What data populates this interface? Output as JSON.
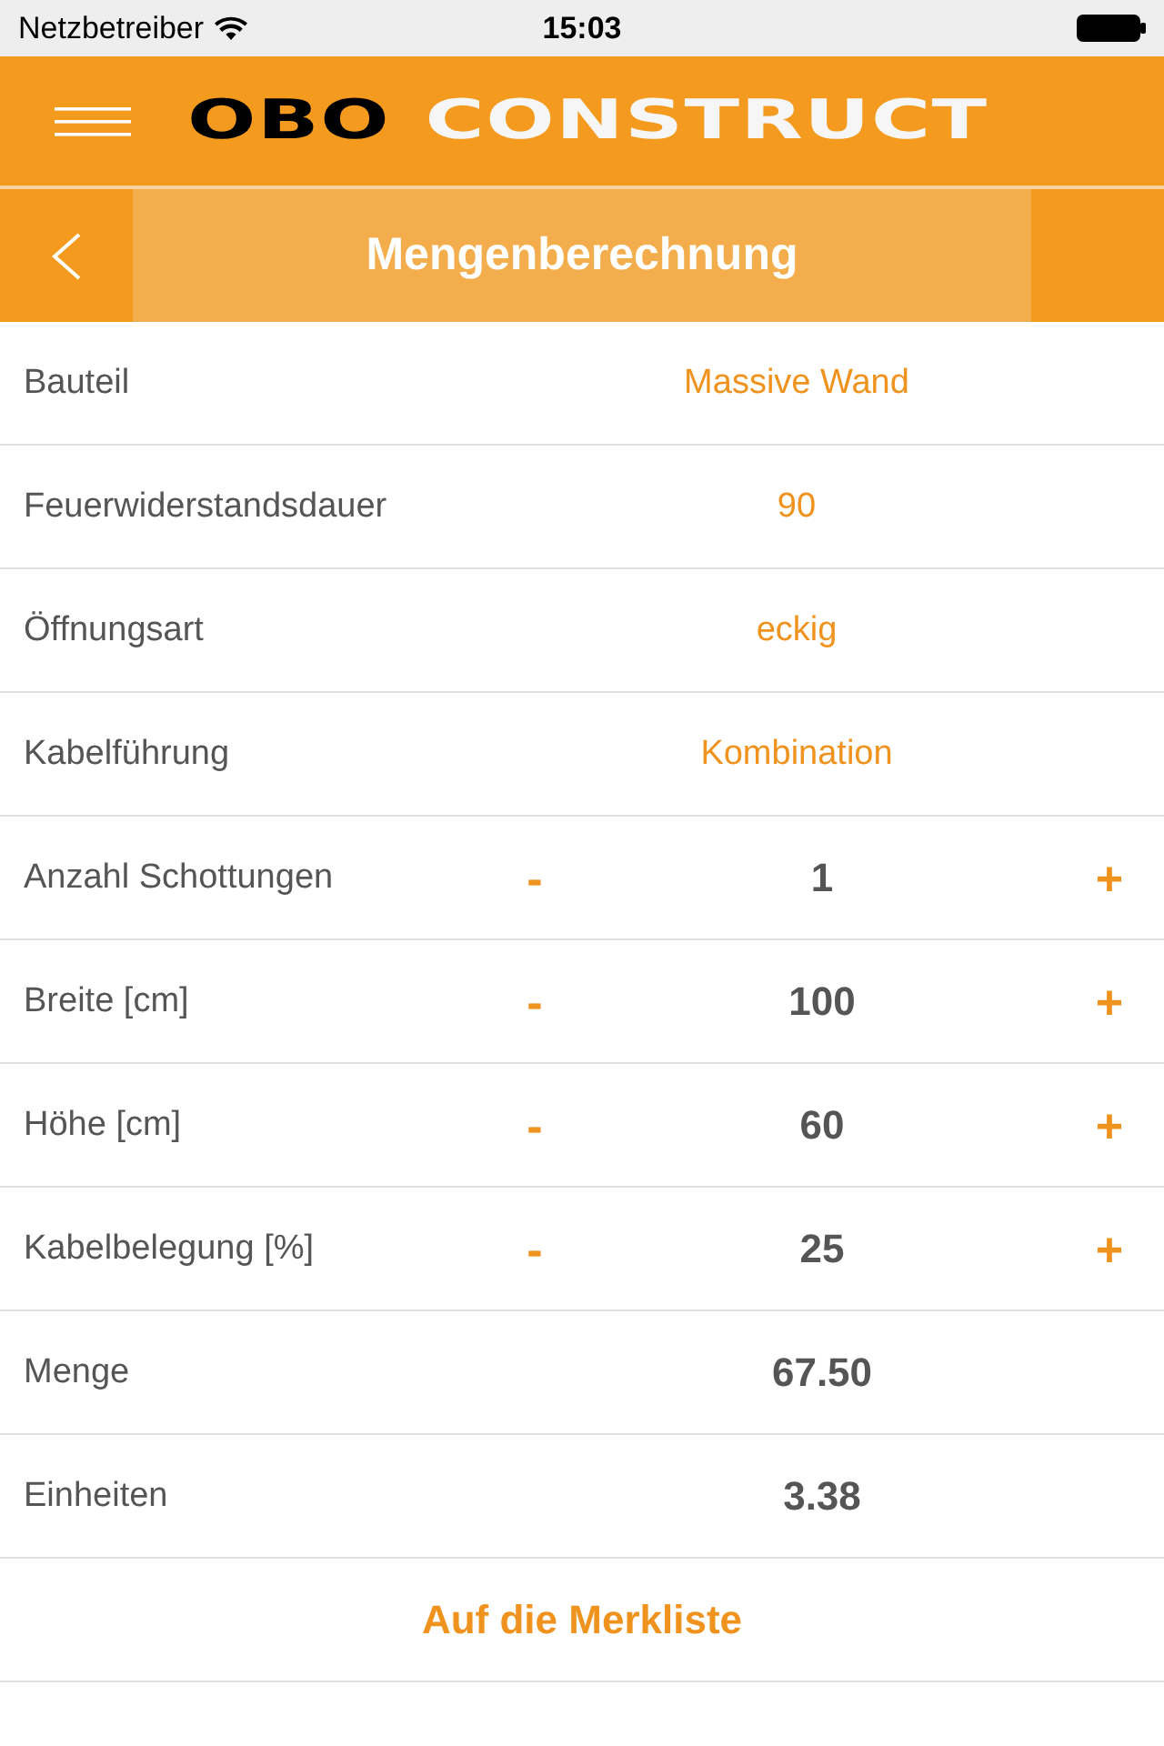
{
  "status_bar": {
    "carrier": "Netzbetreiber",
    "time": "15:03"
  },
  "header": {
    "logo": {
      "brand": "OBO",
      "product": "CONSTRUCT"
    }
  },
  "nav": {
    "title": "Mengenberechnung"
  },
  "fields": [
    {
      "kind": "select",
      "label": "Bauteil",
      "value": "Massive Wand"
    },
    {
      "kind": "select",
      "label": "Feuerwiderstandsdauer",
      "value": "90"
    },
    {
      "kind": "select",
      "label": "Öffnungsart",
      "value": "eckig"
    },
    {
      "kind": "select",
      "label": "Kabelführung",
      "value": "Kombination"
    },
    {
      "kind": "stepper",
      "label": "Anzahl Schottungen",
      "decrement": "-",
      "value": "1",
      "increment": "+"
    },
    {
      "kind": "stepper",
      "label": "Breite [cm]",
      "decrement": "-",
      "value": "100",
      "increment": "+"
    },
    {
      "kind": "stepper",
      "label": "Höhe [cm]",
      "decrement": "-",
      "value": "60",
      "increment": "+"
    },
    {
      "kind": "stepper",
      "label": "Kabelbelegung [%]",
      "decrement": "-",
      "value": "25",
      "increment": "+"
    },
    {
      "kind": "result",
      "label": "Menge",
      "value": "67.50"
    },
    {
      "kind": "result",
      "label": "Einheiten",
      "value": "3.38"
    }
  ],
  "action": {
    "label": "Auf die Merkliste"
  }
}
